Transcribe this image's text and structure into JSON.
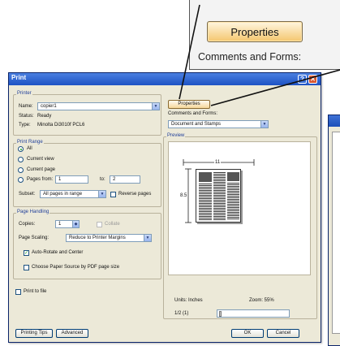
{
  "callout": {
    "properties_label": "Properties",
    "comments_label": "Comments and Forms:"
  },
  "dialog": {
    "title": "Print",
    "help_glyph": "?",
    "close_glyph": "✕",
    "printer": {
      "group_label": "Printer",
      "name_label": "Name:",
      "name_value": "copier1",
      "status_label": "Status:",
      "status_value": "Ready",
      "type_label": "Type:",
      "type_value": "Minolta Di3010f PCL6",
      "properties_label": "Properties",
      "comments_label": "Comments and Forms:",
      "comments_value": "Document and Stamps"
    },
    "print_range": {
      "group_label": "Print Range",
      "all": "All",
      "current_view": "Current view",
      "current_page": "Current page",
      "pages_from": "Pages from:",
      "from_value": "1",
      "to_label": "to:",
      "to_value": "2",
      "subset_label": "Subset:",
      "subset_value": "All pages in range",
      "reverse_label": "Reverse pages"
    },
    "page_handling": {
      "group_label": "Page Handling",
      "copies_label": "Copies:",
      "copies_value": "1",
      "collate_label": "Collate",
      "scaling_label": "Page Scaling:",
      "scaling_value": "Reduce to Printer Margins",
      "auto_rotate_label": "Auto-Rotate and Center",
      "paper_source_label": "Choose Paper Source by PDF page size"
    },
    "print_to_file_label": "Print to file",
    "preview": {
      "group_label": "Preview",
      "width_value": "11",
      "height_value": "8.5",
      "units_label": "Units: Inches",
      "zoom_label": "Zoom: 55%",
      "page_indicator": "1/2 (1)"
    },
    "buttons": {
      "printing_tips": "Printing Tips",
      "advanced": "Advanced",
      "ok": "OK",
      "cancel": "Cancel"
    }
  }
}
